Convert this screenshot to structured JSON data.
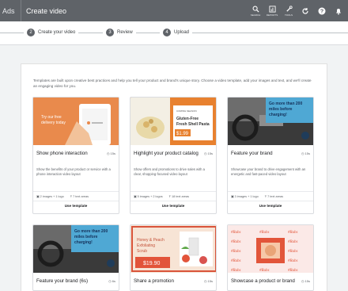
{
  "app": {
    "brand": "Ads",
    "title": "Create video"
  },
  "toolbar": [
    {
      "label": "SEARCH",
      "icon": "search-icon"
    },
    {
      "label": "REPORTS",
      "icon": "reports-icon"
    },
    {
      "label": "TOOLS",
      "icon": "tools-icon"
    }
  ],
  "steps": [
    {
      "num": "2",
      "label": "Create your video"
    },
    {
      "num": "3",
      "label": "Review"
    },
    {
      "num": "4",
      "label": "Upload"
    }
  ],
  "intro": "Templates are built upon creative best practices and help you tell your product and brand's unique story. Choose a video template, add your images and text, and we'll create an engaging video for you.",
  "cards": [
    {
      "name": "Show phone interaction",
      "duration": "15s",
      "desc": "Show the benefits of your product or service with a phone interaction video layout",
      "images": "2 images + 1 logo",
      "text": "7 text areas",
      "use": "Use template",
      "thumb": {
        "line1": "Try our free",
        "line2": "delivery today"
      }
    },
    {
      "name": "Highlight your product catalog",
      "duration": "15s",
      "desc": "Show offers and promotions to drive sales with a clear, shopping-focused video layout",
      "images": "5 images + 2 logos",
      "text": "18 text areas",
      "use": "Use template",
      "thumb": {
        "tag": "COMING SEASON",
        "line1": "Gluten-Free",
        "line2": "Fresh Shell Pasta",
        "price": "$1.99"
      }
    },
    {
      "name": "Feature your brand",
      "duration": "15s",
      "desc": "Showcase your brand to drive engagement with an energetic and fast-paced video layout",
      "images": "3 images + 1 logo",
      "text": "7 text areas",
      "use": "Use template",
      "thumb": {
        "line1": "Go more than 200 miles before charging!"
      }
    },
    {
      "name": "Feature your brand (6s)",
      "duration": "6s",
      "thumb": {
        "line1": "Go more than 200 miles before charging!"
      }
    },
    {
      "name": "Share a promotion",
      "duration": "15s",
      "thumb": {
        "line1": "Honey & Peach",
        "line2": "Exfoliating",
        "line3": "Scrub",
        "price": "$19.90"
      }
    },
    {
      "name": "Showcase a product or brand",
      "duration": "15s",
      "thumb": {
        "line1": "#Rubs"
      }
    }
  ]
}
